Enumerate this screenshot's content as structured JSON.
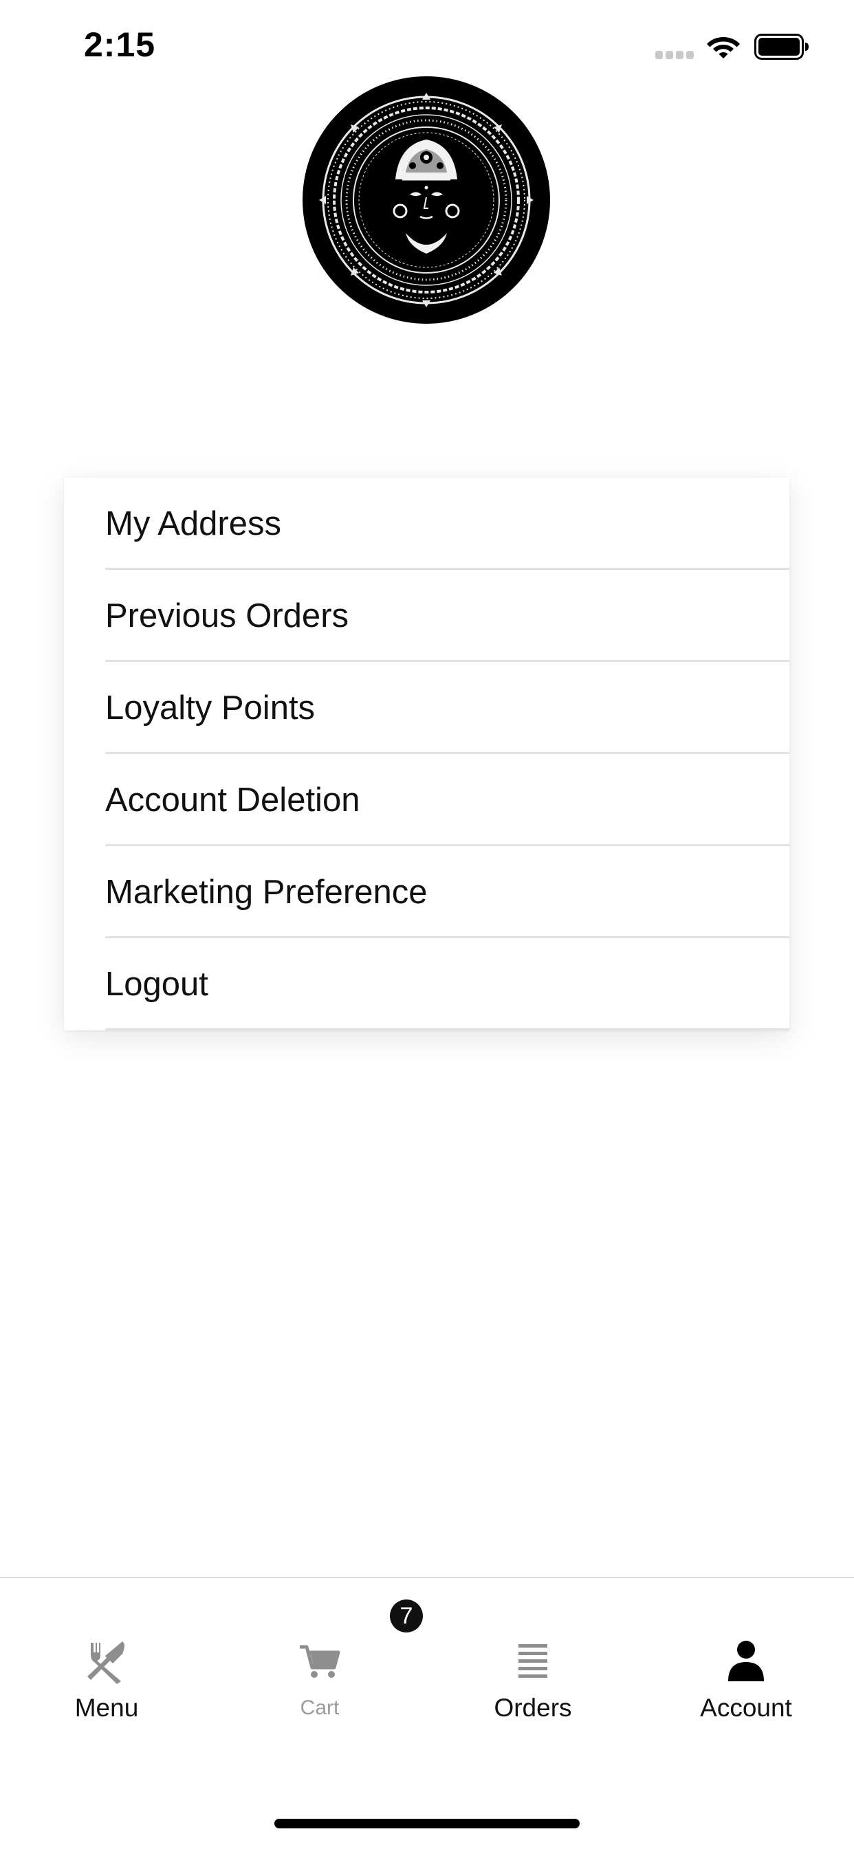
{
  "status_bar": {
    "time": "2:15"
  },
  "logo": {
    "icon": "goddess-mandala-logo"
  },
  "menu": {
    "items": [
      {
        "label": "My Address"
      },
      {
        "label": "Previous Orders"
      },
      {
        "label": "Loyalty Points"
      },
      {
        "label": "Account Deletion"
      },
      {
        "label": "Marketing Preference"
      },
      {
        "label": "Logout"
      }
    ]
  },
  "tab_bar": {
    "tabs": [
      {
        "label": "Menu",
        "icon": "fork-knife-icon",
        "state": "normal"
      },
      {
        "label": "Cart",
        "icon": "cart-icon",
        "state": "muted",
        "badge": "7"
      },
      {
        "label": "Orders",
        "icon": "list-icon",
        "state": "normal"
      },
      {
        "label": "Account",
        "icon": "person-icon",
        "state": "active"
      }
    ]
  },
  "colors": {
    "text": "#111111",
    "muted_text": "#9a9a9a",
    "icon_gray": "#8e8e8e",
    "divider": "#e2e2e2",
    "badge_bg": "#111111"
  }
}
